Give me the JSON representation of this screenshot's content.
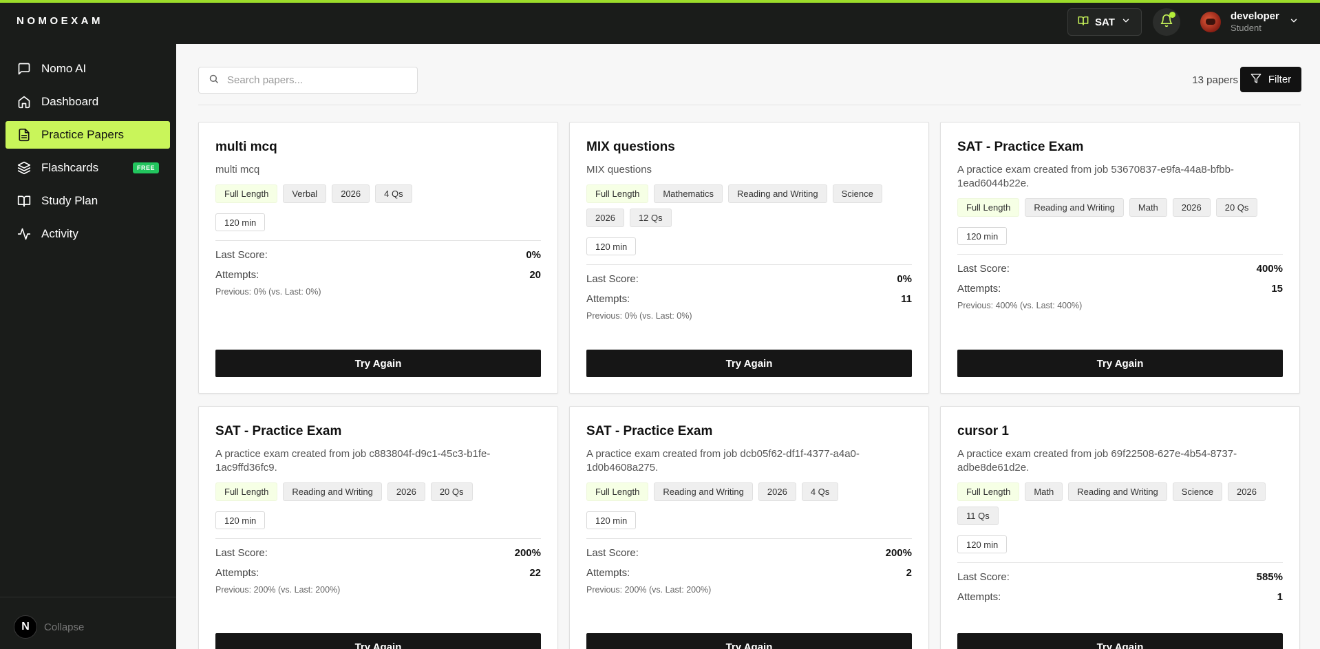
{
  "brand": "NOMOEXAM",
  "header": {
    "exam_selector": "SAT",
    "user": {
      "name": "developer",
      "role": "Student"
    }
  },
  "sidebar": {
    "items": [
      {
        "label": "Nomo AI",
        "icon": "chat-icon"
      },
      {
        "label": "Dashboard",
        "icon": "home-icon"
      },
      {
        "label": "Practice Papers",
        "icon": "document-icon",
        "active": true
      },
      {
        "label": "Flashcards",
        "icon": "layers-icon",
        "badge": "FREE"
      },
      {
        "label": "Study Plan",
        "icon": "book-icon"
      },
      {
        "label": "Activity",
        "icon": "activity-icon"
      }
    ],
    "collapse_label": "Collapse",
    "collapse_logo": "N"
  },
  "toolbar": {
    "search_placeholder": "Search papers...",
    "paper_count": "13 papers",
    "filter_label": "Filter"
  },
  "labels": {
    "last_score": "Last Score:",
    "attempts": "Attempts:",
    "try_again": "Try Again"
  },
  "papers": [
    {
      "title": "multi mcq",
      "description": "multi mcq",
      "tags": [
        "Full Length",
        "Verbal",
        "2026",
        "4 Qs"
      ],
      "duration": "120 min",
      "last_score": "0%",
      "attempts": "20",
      "previous": "Previous: 0% (vs. Last: 0%)"
    },
    {
      "title": "MIX questions",
      "description": "MIX questions",
      "tags": [
        "Full Length",
        "Mathematics",
        "Reading and Writing",
        "Science",
        "2026",
        "12 Qs"
      ],
      "duration": "120 min",
      "last_score": "0%",
      "attempts": "11",
      "previous": "Previous: 0% (vs. Last: 0%)"
    },
    {
      "title": "SAT - Practice Exam",
      "description": "A practice exam created from job 53670837-e9fa-44a8-bfbb-1ead6044b22e.",
      "tags": [
        "Full Length",
        "Reading and Writing",
        "Math",
        "2026",
        "20 Qs"
      ],
      "duration": "120 min",
      "last_score": "400%",
      "attempts": "15",
      "previous": "Previous: 400% (vs. Last: 400%)"
    },
    {
      "title": "SAT - Practice Exam",
      "description": "A practice exam created from job c883804f-d9c1-45c3-b1fe-1ac9ffd36fc9.",
      "tags": [
        "Full Length",
        "Reading and Writing",
        "2026",
        "20 Qs"
      ],
      "duration": "120 min",
      "last_score": "200%",
      "attempts": "22",
      "previous": "Previous: 200% (vs. Last: 200%)"
    },
    {
      "title": "SAT - Practice Exam",
      "description": "A practice exam created from job dcb05f62-df1f-4377-a4a0-1d0b4608a275.",
      "tags": [
        "Full Length",
        "Reading and Writing",
        "2026",
        "4 Qs"
      ],
      "duration": "120 min",
      "last_score": "200%",
      "attempts": "2",
      "previous": "Previous: 200% (vs. Last: 200%)"
    },
    {
      "title": "cursor 1",
      "description": "A practice exam created from job 69f22508-627e-4b54-8737-adbe8de61d2e.",
      "tags": [
        "Full Length",
        "Math",
        "Reading and Writing",
        "Science",
        "2026",
        "11 Qs"
      ],
      "duration": "120 min",
      "last_score": "585%",
      "attempts": "1",
      "previous": ""
    }
  ],
  "colors": {
    "accent": "#c9f55a",
    "topbar_stripe": "#9cdc2a",
    "sidebar_bg": "#1a1c1a",
    "badge_green": "#22c55e"
  }
}
